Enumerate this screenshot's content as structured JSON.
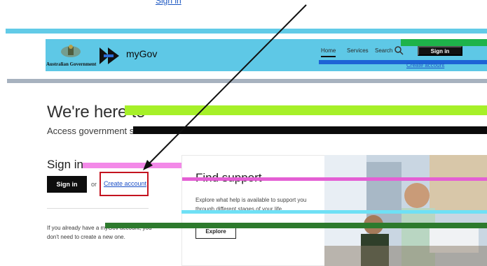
{
  "top_link": "Sign in",
  "header": {
    "gov_label": "Australian Government",
    "brand": "myGov",
    "nav": [
      "Home",
      "Services",
      "Search"
    ],
    "sign_in": "Sign in",
    "create_account": "Create account"
  },
  "hero": {
    "title": "We're here to",
    "subtitle": "Access government s"
  },
  "signin": {
    "heading": "Sign in",
    "button": "Sign in",
    "or": "or",
    "create_account": "Create account",
    "info": "If you already have a myGov account, you don't need to create a new one."
  },
  "support": {
    "title": "Find support",
    "body": "Explore what help is available to support you through different stages of your life.",
    "button": "Explore"
  },
  "colors": {
    "accent_cyan": "#5ec8e6",
    "annotation_red": "#c4131f",
    "link_blue": "#1b4fc7"
  },
  "icons": {
    "search": "search-icon",
    "crest": "coat-of-arms-icon",
    "logo": "mygov-logo-icon"
  }
}
